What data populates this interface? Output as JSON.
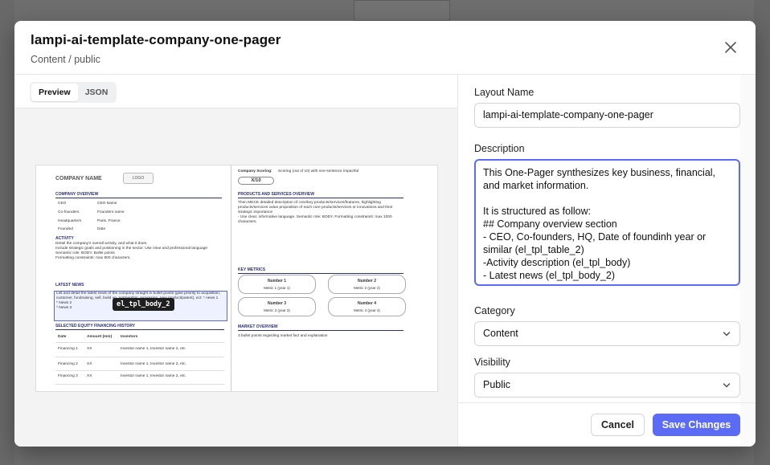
{
  "modal": {
    "title": "lampi-ai-template-company-one-pager",
    "subtitle": "Content / public"
  },
  "tabs": [
    {
      "label": "Preview",
      "active": true
    },
    {
      "label": "JSON",
      "active": false
    }
  ],
  "preview_doc": {
    "company_name": "COMPANY NAME",
    "logo": "LOGO",
    "company_overview": "COMPANY OVERVIEW",
    "rows": [
      {
        "k": "CEO",
        "v": "CEO Name"
      },
      {
        "k": "Co-founders",
        "v": "Founders name"
      },
      {
        "k": "Headquarters",
        "v": "Paris, France"
      },
      {
        "k": "Founded",
        "v": "Date"
      }
    ],
    "activity_h": "ACTIVITY",
    "activity_t": "Detail the company's overall activity, and what it does.\nInclude strategic goals and positioning in the sector. Use clear and professional language\nSemantic role: BODY. Bullet points\nFormatting constraints: max 800 characters.",
    "latest_news_h": "LATEST NEWS",
    "latest_news_t": "List and detail the latest news of the company straight in bullet points (give priority to acquisition, customer, fundraising, sell, build up, partnership, expansion, new product/patent), ect: * news 1\n* News 2\n* News 3",
    "chip": "el_tpl_body_2",
    "equity_h": "SELECTED EQUITY FINANCING HISTORY",
    "equity_cols": [
      "Date",
      "Amount (mm)",
      "Investors"
    ],
    "equity_rows": [
      [
        "Financing 1",
        "XX",
        "Investor name 1, Investor name 2, etc."
      ],
      [
        "Financing 2",
        "XX",
        "Investor name 1, Investor name 2, etc."
      ],
      [
        "Financing 3",
        "XX",
        "Investor name 1, Investor name 2, etc."
      ]
    ],
    "scoring_label": "Company Scoring:",
    "scoring_text": "Scoring (out of 10) with one-sentence impactful",
    "score": "X/10",
    "products_h": "PRODUCTS AND SERVICES OVERVIEW",
    "products_t": "Then MECE detailed description of core/key products/services/features, highlighting products/services value proposition of each core products/services or innovations and their strategic importance\n- Use clear, informative language. Semantic role: BODY. Formatting constraints: max 1000 characters.",
    "key_metrics_h": "KEY METRICS",
    "metrics": [
      {
        "h": "Number 1",
        "v": "Metric 1 (year 1)"
      },
      {
        "h": "Number 2",
        "v": "Metric 2 (year 2)"
      },
      {
        "h": "Number 3",
        "v": "Metric 3 (year 3)"
      },
      {
        "h": "Number 4",
        "v": "Metric 4 (year 4)"
      }
    ],
    "market_h": "MARKET OVERVIEW",
    "market_t": "3 bullet points regarding market fact and explanation"
  },
  "form": {
    "layout_name_label": "Layout Name",
    "layout_name_value": "lampi-ai-template-company-one-pager",
    "description_label": "Description",
    "description_value": "This One-Pager synthesizes key business, financial, and market information.\n\nIt is structured as follow:\n## Company overview section\n- CEO, Co-founders, HQ, Date of foundinh year or similar (el_tpl_table_2)\n-Activity description (el_tpl_body)\n- Latest news (el_tpl_body_2)",
    "category_label": "Category",
    "category_value": "Content",
    "visibility_label": "Visibility",
    "visibility_value": "Public"
  },
  "footer": {
    "cancel_label": "Cancel",
    "save_label": "Save Changes"
  },
  "colors": {
    "accent": "#5b6bf5",
    "overlay": "#000000"
  }
}
